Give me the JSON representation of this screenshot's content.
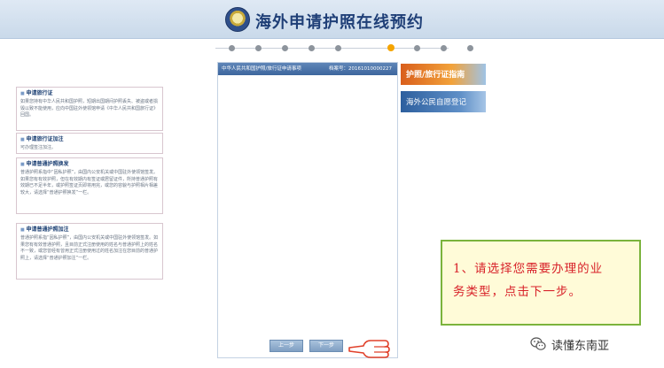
{
  "header": {
    "title": "海外申请护照在线预约"
  },
  "progress": {
    "steps": 9,
    "active_step": 6
  },
  "form": {
    "header_title": "中华人民共和国护照/旅行证申请事项",
    "file_no_label": "档案号：20161010000227",
    "options": [
      {
        "title": "申请旅行证",
        "desc": "如果您持有中华人民共和国护照，短期出国期间护照丢失、被盗或者损毁以致不能使用，应向中国驻外使领馆申请《中华人民共和国旅行证》回国。"
      },
      {
        "title": "申请旅行证加注",
        "desc": "可办理签注加注。"
      },
      {
        "title": "申请普通护照换发",
        "desc": "普通护照系指中“因私护照”，由国内公安机关或中国驻外使领馆签发。如果您有有效护照，但在有效期内有签证或居留证件，所持普通护照有效期已不足半年，或护照签证页即将用完，或您的容貌与护照相片相差较大，请选择“普通护照换发”一栏。"
      },
      {
        "title": "申请普通护照加注",
        "desc": "普通护照系指“因私护照”，由国内公安机关或中国驻外使领馆签发。如果您有有效普通护照，且目前正式注册使用的姓名与普通护照上的姓名不一致，或您曾经有曾用正式注册使用过的姓名加注在您目前的普通护照上，请选择“普通护照加注”一栏。"
      }
    ],
    "prev_button": "上一步",
    "next_button": "下一步"
  },
  "sidebar": {
    "banner_guide": "护照/旅行证指南",
    "banner_register": "海外公民自愿登记"
  },
  "callout": {
    "line1": "1、请选择您需要办理的业",
    "line2": "务类型，点击下一步。"
  },
  "watermark": {
    "text": "读懂东南亚"
  },
  "colors": {
    "header_title": "#1f3f77",
    "callout_text": "#d8232a",
    "callout_border": "#7bb33c",
    "callout_bg": "#fffbd8",
    "active_step": "#f5a400"
  }
}
